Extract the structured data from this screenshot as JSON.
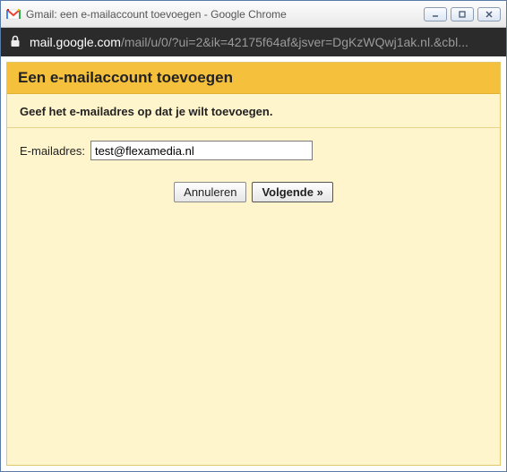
{
  "window": {
    "title": "Gmail: een e-mailaccount toevoegen - Google Chrome"
  },
  "address": {
    "domain": "mail.google.com",
    "path": "/mail/u/0/?ui=2&ik=42175f64af&jsver=DgKzWQwj1ak.nl.&cbl..."
  },
  "panel": {
    "title": "Een e-mailaccount toevoegen",
    "subtitle": "Geef het e-mailadres op dat je wilt toevoegen."
  },
  "form": {
    "email_label": "E-mailadres:",
    "email_value": "test@flexamedia.nl"
  },
  "buttons": {
    "cancel": "Annuleren",
    "next": "Volgende »"
  }
}
